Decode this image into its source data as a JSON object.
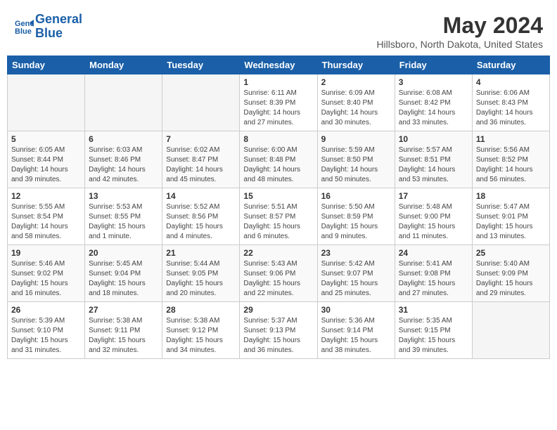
{
  "header": {
    "logo_line1": "General",
    "logo_line2": "Blue",
    "month": "May 2024",
    "location": "Hillsboro, North Dakota, United States"
  },
  "weekdays": [
    "Sunday",
    "Monday",
    "Tuesday",
    "Wednesday",
    "Thursday",
    "Friday",
    "Saturday"
  ],
  "weeks": [
    [
      {
        "day": "",
        "info": ""
      },
      {
        "day": "",
        "info": ""
      },
      {
        "day": "",
        "info": ""
      },
      {
        "day": "1",
        "info": "Sunrise: 6:11 AM\nSunset: 8:39 PM\nDaylight: 14 hours\nand 27 minutes."
      },
      {
        "day": "2",
        "info": "Sunrise: 6:09 AM\nSunset: 8:40 PM\nDaylight: 14 hours\nand 30 minutes."
      },
      {
        "day": "3",
        "info": "Sunrise: 6:08 AM\nSunset: 8:42 PM\nDaylight: 14 hours\nand 33 minutes."
      },
      {
        "day": "4",
        "info": "Sunrise: 6:06 AM\nSunset: 8:43 PM\nDaylight: 14 hours\nand 36 minutes."
      }
    ],
    [
      {
        "day": "5",
        "info": "Sunrise: 6:05 AM\nSunset: 8:44 PM\nDaylight: 14 hours\nand 39 minutes."
      },
      {
        "day": "6",
        "info": "Sunrise: 6:03 AM\nSunset: 8:46 PM\nDaylight: 14 hours\nand 42 minutes."
      },
      {
        "day": "7",
        "info": "Sunrise: 6:02 AM\nSunset: 8:47 PM\nDaylight: 14 hours\nand 45 minutes."
      },
      {
        "day": "8",
        "info": "Sunrise: 6:00 AM\nSunset: 8:48 PM\nDaylight: 14 hours\nand 48 minutes."
      },
      {
        "day": "9",
        "info": "Sunrise: 5:59 AM\nSunset: 8:50 PM\nDaylight: 14 hours\nand 50 minutes."
      },
      {
        "day": "10",
        "info": "Sunrise: 5:57 AM\nSunset: 8:51 PM\nDaylight: 14 hours\nand 53 minutes."
      },
      {
        "day": "11",
        "info": "Sunrise: 5:56 AM\nSunset: 8:52 PM\nDaylight: 14 hours\nand 56 minutes."
      }
    ],
    [
      {
        "day": "12",
        "info": "Sunrise: 5:55 AM\nSunset: 8:54 PM\nDaylight: 14 hours\nand 58 minutes."
      },
      {
        "day": "13",
        "info": "Sunrise: 5:53 AM\nSunset: 8:55 PM\nDaylight: 15 hours\nand 1 minute."
      },
      {
        "day": "14",
        "info": "Sunrise: 5:52 AM\nSunset: 8:56 PM\nDaylight: 15 hours\nand 4 minutes."
      },
      {
        "day": "15",
        "info": "Sunrise: 5:51 AM\nSunset: 8:57 PM\nDaylight: 15 hours\nand 6 minutes."
      },
      {
        "day": "16",
        "info": "Sunrise: 5:50 AM\nSunset: 8:59 PM\nDaylight: 15 hours\nand 9 minutes."
      },
      {
        "day": "17",
        "info": "Sunrise: 5:48 AM\nSunset: 9:00 PM\nDaylight: 15 hours\nand 11 minutes."
      },
      {
        "day": "18",
        "info": "Sunrise: 5:47 AM\nSunset: 9:01 PM\nDaylight: 15 hours\nand 13 minutes."
      }
    ],
    [
      {
        "day": "19",
        "info": "Sunrise: 5:46 AM\nSunset: 9:02 PM\nDaylight: 15 hours\nand 16 minutes."
      },
      {
        "day": "20",
        "info": "Sunrise: 5:45 AM\nSunset: 9:04 PM\nDaylight: 15 hours\nand 18 minutes."
      },
      {
        "day": "21",
        "info": "Sunrise: 5:44 AM\nSunset: 9:05 PM\nDaylight: 15 hours\nand 20 minutes."
      },
      {
        "day": "22",
        "info": "Sunrise: 5:43 AM\nSunset: 9:06 PM\nDaylight: 15 hours\nand 22 minutes."
      },
      {
        "day": "23",
        "info": "Sunrise: 5:42 AM\nSunset: 9:07 PM\nDaylight: 15 hours\nand 25 minutes."
      },
      {
        "day": "24",
        "info": "Sunrise: 5:41 AM\nSunset: 9:08 PM\nDaylight: 15 hours\nand 27 minutes."
      },
      {
        "day": "25",
        "info": "Sunrise: 5:40 AM\nSunset: 9:09 PM\nDaylight: 15 hours\nand 29 minutes."
      }
    ],
    [
      {
        "day": "26",
        "info": "Sunrise: 5:39 AM\nSunset: 9:10 PM\nDaylight: 15 hours\nand 31 minutes."
      },
      {
        "day": "27",
        "info": "Sunrise: 5:38 AM\nSunset: 9:11 PM\nDaylight: 15 hours\nand 32 minutes."
      },
      {
        "day": "28",
        "info": "Sunrise: 5:38 AM\nSunset: 9:12 PM\nDaylight: 15 hours\nand 34 minutes."
      },
      {
        "day": "29",
        "info": "Sunrise: 5:37 AM\nSunset: 9:13 PM\nDaylight: 15 hours\nand 36 minutes."
      },
      {
        "day": "30",
        "info": "Sunrise: 5:36 AM\nSunset: 9:14 PM\nDaylight: 15 hours\nand 38 minutes."
      },
      {
        "day": "31",
        "info": "Sunrise: 5:35 AM\nSunset: 9:15 PM\nDaylight: 15 hours\nand 39 minutes."
      },
      {
        "day": "",
        "info": ""
      }
    ]
  ]
}
